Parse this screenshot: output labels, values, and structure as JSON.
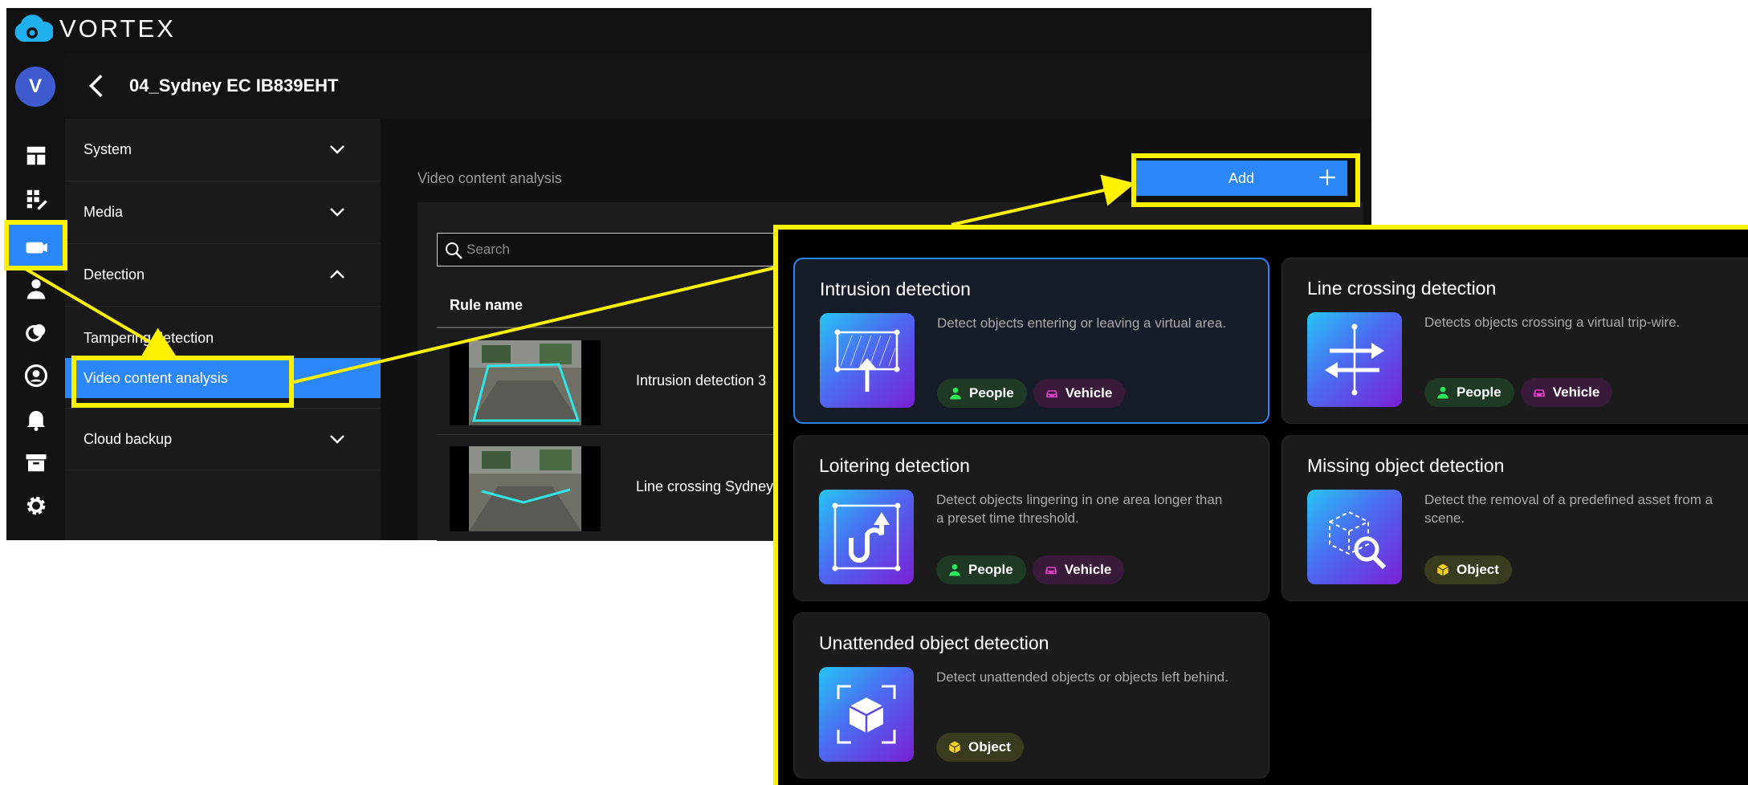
{
  "brand": "VORTEX",
  "colors": {
    "accent": "#2b86f7",
    "highlight": "#fff200",
    "people": "#2ee65a",
    "vehicle": "#e040c8",
    "object": "#f2d027"
  },
  "user": {
    "initial": "V"
  },
  "rail": {
    "icons": [
      "dashboard-icon",
      "layout-grid-icon",
      "camera-icon",
      "person-icon",
      "overlap-icon",
      "user-circle-icon",
      "bell-icon",
      "archive-icon",
      "gear-icon"
    ]
  },
  "header": {
    "title": "04_Sydney EC IB839EHT"
  },
  "menu": {
    "items": [
      {
        "label": "System"
      },
      {
        "label": "Media"
      },
      {
        "label": "Detection"
      },
      {
        "label": "Cloud backup"
      }
    ],
    "detection_sub": [
      {
        "label": "Tampering detection"
      },
      {
        "label": "Video content analysis"
      }
    ]
  },
  "main": {
    "section_title": "Video content analysis",
    "add_label": "Add",
    "search_placeholder": "Search",
    "column_rule_name": "Rule name",
    "rules": [
      {
        "name": "Intrusion detection 3"
      },
      {
        "name": "Line crossing Sydney EC"
      }
    ]
  },
  "popup": {
    "cards": [
      {
        "title": "Intrusion detection",
        "desc": "Detect objects entering or leaving a virtual area.",
        "tags": [
          "People",
          "Vehicle"
        ]
      },
      {
        "title": "Line crossing detection",
        "desc": "Detects objects crossing a virtual trip-wire.",
        "tags": [
          "People",
          "Vehicle"
        ]
      },
      {
        "title": "Loitering detection",
        "desc": "Detect objects lingering in one area longer than a preset time threshold.",
        "tags": [
          "People",
          "Vehicle"
        ]
      },
      {
        "title": "Missing object detection",
        "desc": "Detect the removal of a predefined asset from a scene.",
        "tags": [
          "Object"
        ]
      },
      {
        "title": "Unattended object detection",
        "desc": "Detect unattended objects or objects left behind.",
        "tags": [
          "Object"
        ]
      }
    ]
  }
}
